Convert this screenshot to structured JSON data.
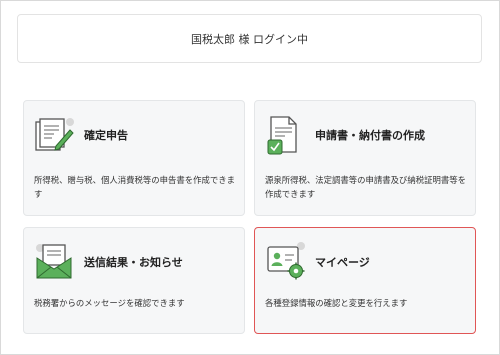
{
  "login": {
    "text": "国税太郎 様 ログイン中"
  },
  "cards": [
    {
      "title": "確定申告",
      "description": "所得税、贈与税、個人消費税等の申告書を作成できます",
      "icon": "tax-return-document-icon"
    },
    {
      "title": "申請書・納付書の作成",
      "description": "源泉所得税、法定調書等の申請書及び納税証明書等を作成できます",
      "icon": "application-form-icon"
    },
    {
      "title": "送信結果・お知らせ",
      "description": "税務署からのメッセージを確認できます",
      "icon": "mail-envelope-icon"
    },
    {
      "title": "マイページ",
      "description": "各種登録情報の確認と変更を行えます",
      "icon": "mypage-profile-icon"
    }
  ],
  "colors": {
    "accent_green": "#5bb05b",
    "selected_border": "#e05656",
    "card_bg": "#f6f7f8"
  }
}
